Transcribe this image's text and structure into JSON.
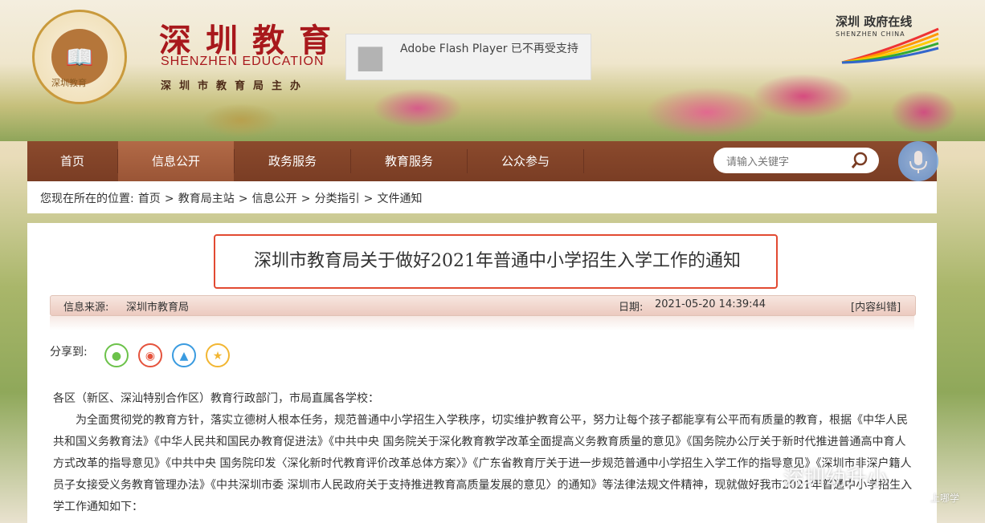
{
  "header": {
    "logo_caption": "深圳教育",
    "title_cn": "深圳教育",
    "title_en": "SHENZHEN EDUCATION",
    "subtitle": "深圳市教育局主办",
    "flash_message": "Adobe Flash Player 已不再受支持",
    "right_logo_cn": "深圳 政府在线",
    "right_logo_en": "SHENZHEN CHINA"
  },
  "nav": {
    "items": [
      {
        "label": "首页"
      },
      {
        "label": "信息公开"
      },
      {
        "label": "政务服务"
      },
      {
        "label": "教育服务"
      },
      {
        "label": "公众参与"
      }
    ],
    "search_placeholder": "请输入关键字"
  },
  "breadcrumb": {
    "prefix": "您现在所在的位置:",
    "items": [
      "首页",
      "教育局主站",
      "信息公开",
      "分类指引",
      "文件通知"
    ],
    "separator": ">"
  },
  "article": {
    "title": "深圳市教育局关于做好2021年普通中小学招生入学工作的通知",
    "source_label": "信息来源:",
    "source_value": "深圳市教育局",
    "date_label": "日期:",
    "date_value": "2021-05-20 14:39:44",
    "report_link": "[内容纠错]",
    "share_label": "分享到:",
    "share_icons": [
      "wechat-icon",
      "weibo-icon",
      "qq-icon",
      "qzone-icon"
    ],
    "paragraphs": [
      "各区（新区、深汕特别合作区）教育行政部门，市局直属各学校：",
      "为全面贯彻党的教育方针，落实立德树人根本任务，规范普通中小学招生入学秩序，切实维护教育公平，努力让每个孩子都能享有公平而有质量的教育，根据《中华人民共和国义务教育法》《中华人民共和国民办教育促进法》《中共中央 国务院关于深化教育教学改革全面提高义务教育质量的意见》《国务院办公厅关于新时代推进普通高中育人方式改革的指导意见》《中共中央 国务院印发〈深化新时代教育评价改革总体方案〉》《广东省教育厅关于进一步规范普通中小学招生入学工作的指导意见》《深圳市非深户籍人员子女接受义务教育管理办法》《中共深圳市委 深圳市人民政府关于支持推进教育高质量发展的意见〉的通知》等法律法规文件精神，现就做好我市2021年普通中小学招生入学工作通知如下："
    ]
  },
  "watermark": {
    "main": "深圳幼升小",
    "sub": "上哪学"
  },
  "colors": {
    "nav_bg": "#7a3d24",
    "title_red": "#a8181c",
    "highlight_border": "#e24a32"
  }
}
